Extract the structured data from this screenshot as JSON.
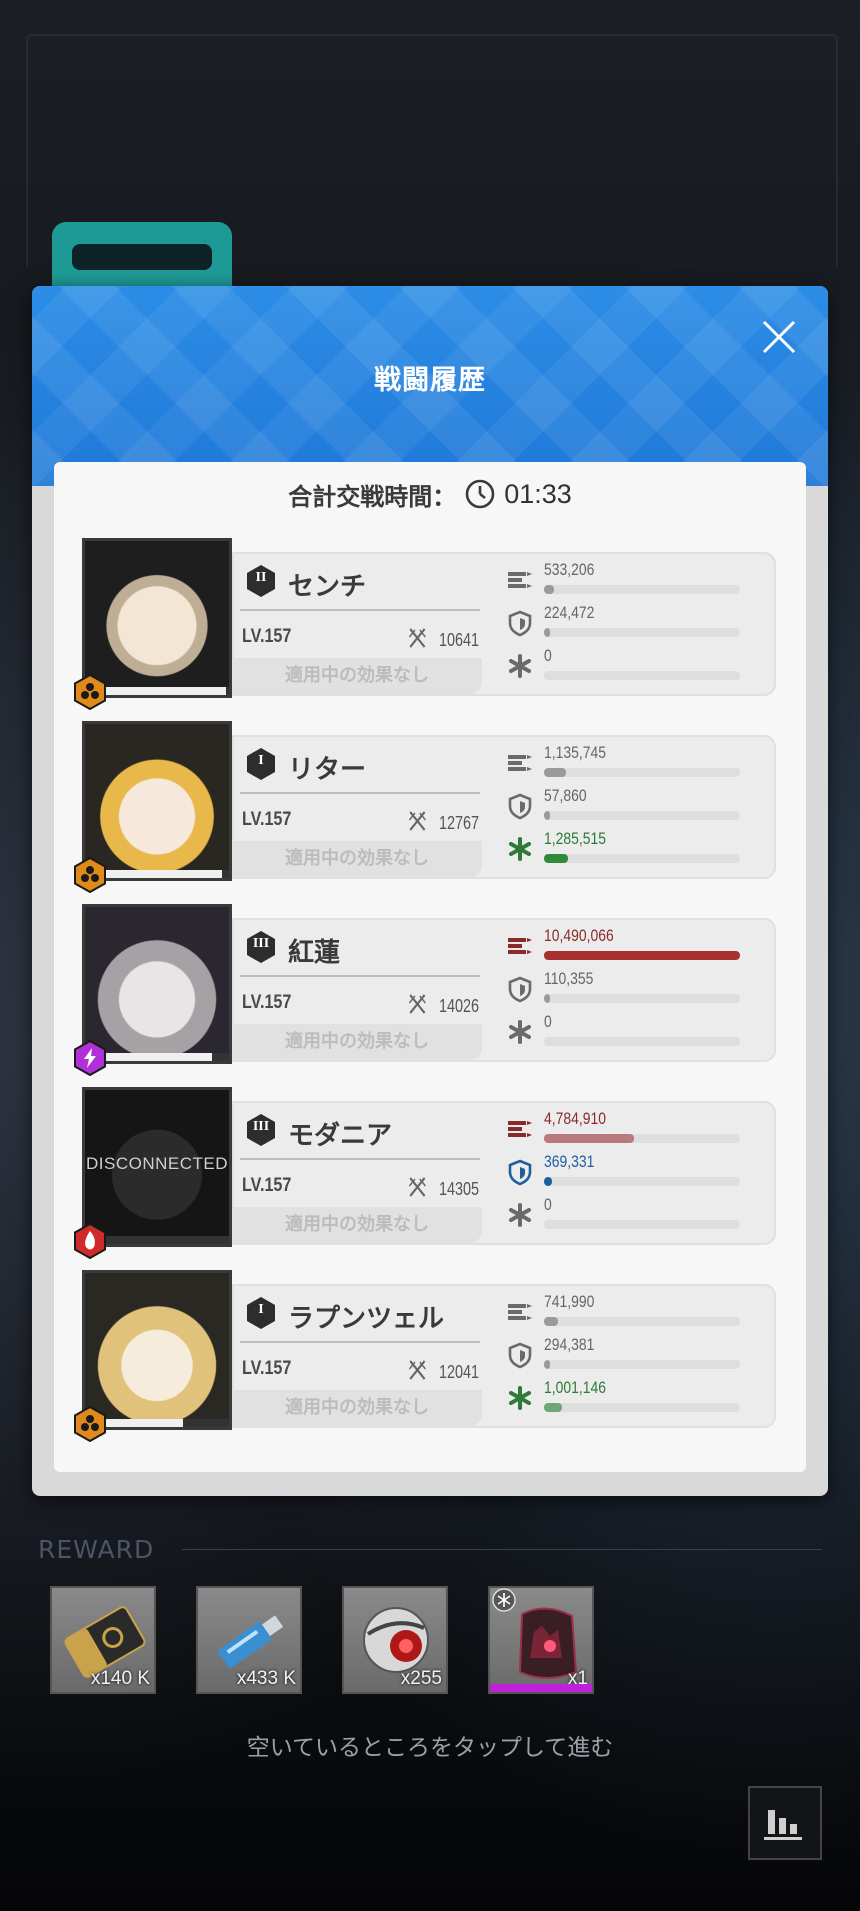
{
  "dialog": {
    "title": "戦闘履歴",
    "total_label": "合計交戦時間：",
    "total_time": "01:33"
  },
  "colors": {
    "header_blue": "#1f78d8",
    "damage_red": "#a8302f",
    "heal_green": "#2e8b3a",
    "shield_blue": "#1f5fa0",
    "burst_orange": "#e08a1a"
  },
  "characters": [
    {
      "rank": "II",
      "name": "センチ",
      "level": "LV.157",
      "power": "10641",
      "effect": "適用中の効果なし",
      "burst_icon": "hexagon-icon",
      "damage": "533,206",
      "damage_pct": 5,
      "defense": "224,472",
      "defense_pct": 2,
      "heal": "0",
      "heal_pct": 0
    },
    {
      "rank": "I",
      "name": "リター",
      "level": "LV.157",
      "power": "12767",
      "effect": "適用中の効果なし",
      "burst_icon": "hexagon-icon",
      "damage": "1,135,745",
      "damage_pct": 11,
      "defense": "57,860",
      "defense_pct": 1,
      "heal": "1,285,515",
      "heal_pct": 12
    },
    {
      "rank": "III",
      "name": "紅蓮",
      "level": "LV.157",
      "power": "14026",
      "effect": "適用中の効果なし",
      "burst_icon": "lightning-icon",
      "damage": "10,490,066",
      "damage_pct": 100,
      "defense": "110,355",
      "defense_pct": 1,
      "heal": "0",
      "heal_pct": 0
    },
    {
      "rank": "III",
      "name": "モダニア",
      "level": "LV.157",
      "power": "14305",
      "effect": "適用中の効果なし",
      "burst_icon": "fire-icon",
      "portrait_text": "DISCONNECTED",
      "damage": "4,784,910",
      "damage_pct": 46,
      "defense": "369,331",
      "defense_pct": 4,
      "heal": "0",
      "heal_pct": 0
    },
    {
      "rank": "I",
      "name": "ラプンツェル",
      "level": "LV.157",
      "power": "12041",
      "effect": "適用中の効果なし",
      "burst_icon": "hexagon-icon",
      "damage": "741,990",
      "damage_pct": 7,
      "defense": "294,381",
      "defense_pct": 3,
      "heal": "1,001,146",
      "heal_pct": 9
    }
  ],
  "reward": {
    "label": "REWARD",
    "items": [
      {
        "name": "credit-card",
        "qty": "x140 K"
      },
      {
        "name": "usb-data",
        "qty": "x433 K"
      },
      {
        "name": "core-orb",
        "qty": "x255"
      },
      {
        "name": "gear-equipment",
        "qty": "x1"
      }
    ]
  },
  "hint": "空いているところをタップして進む"
}
